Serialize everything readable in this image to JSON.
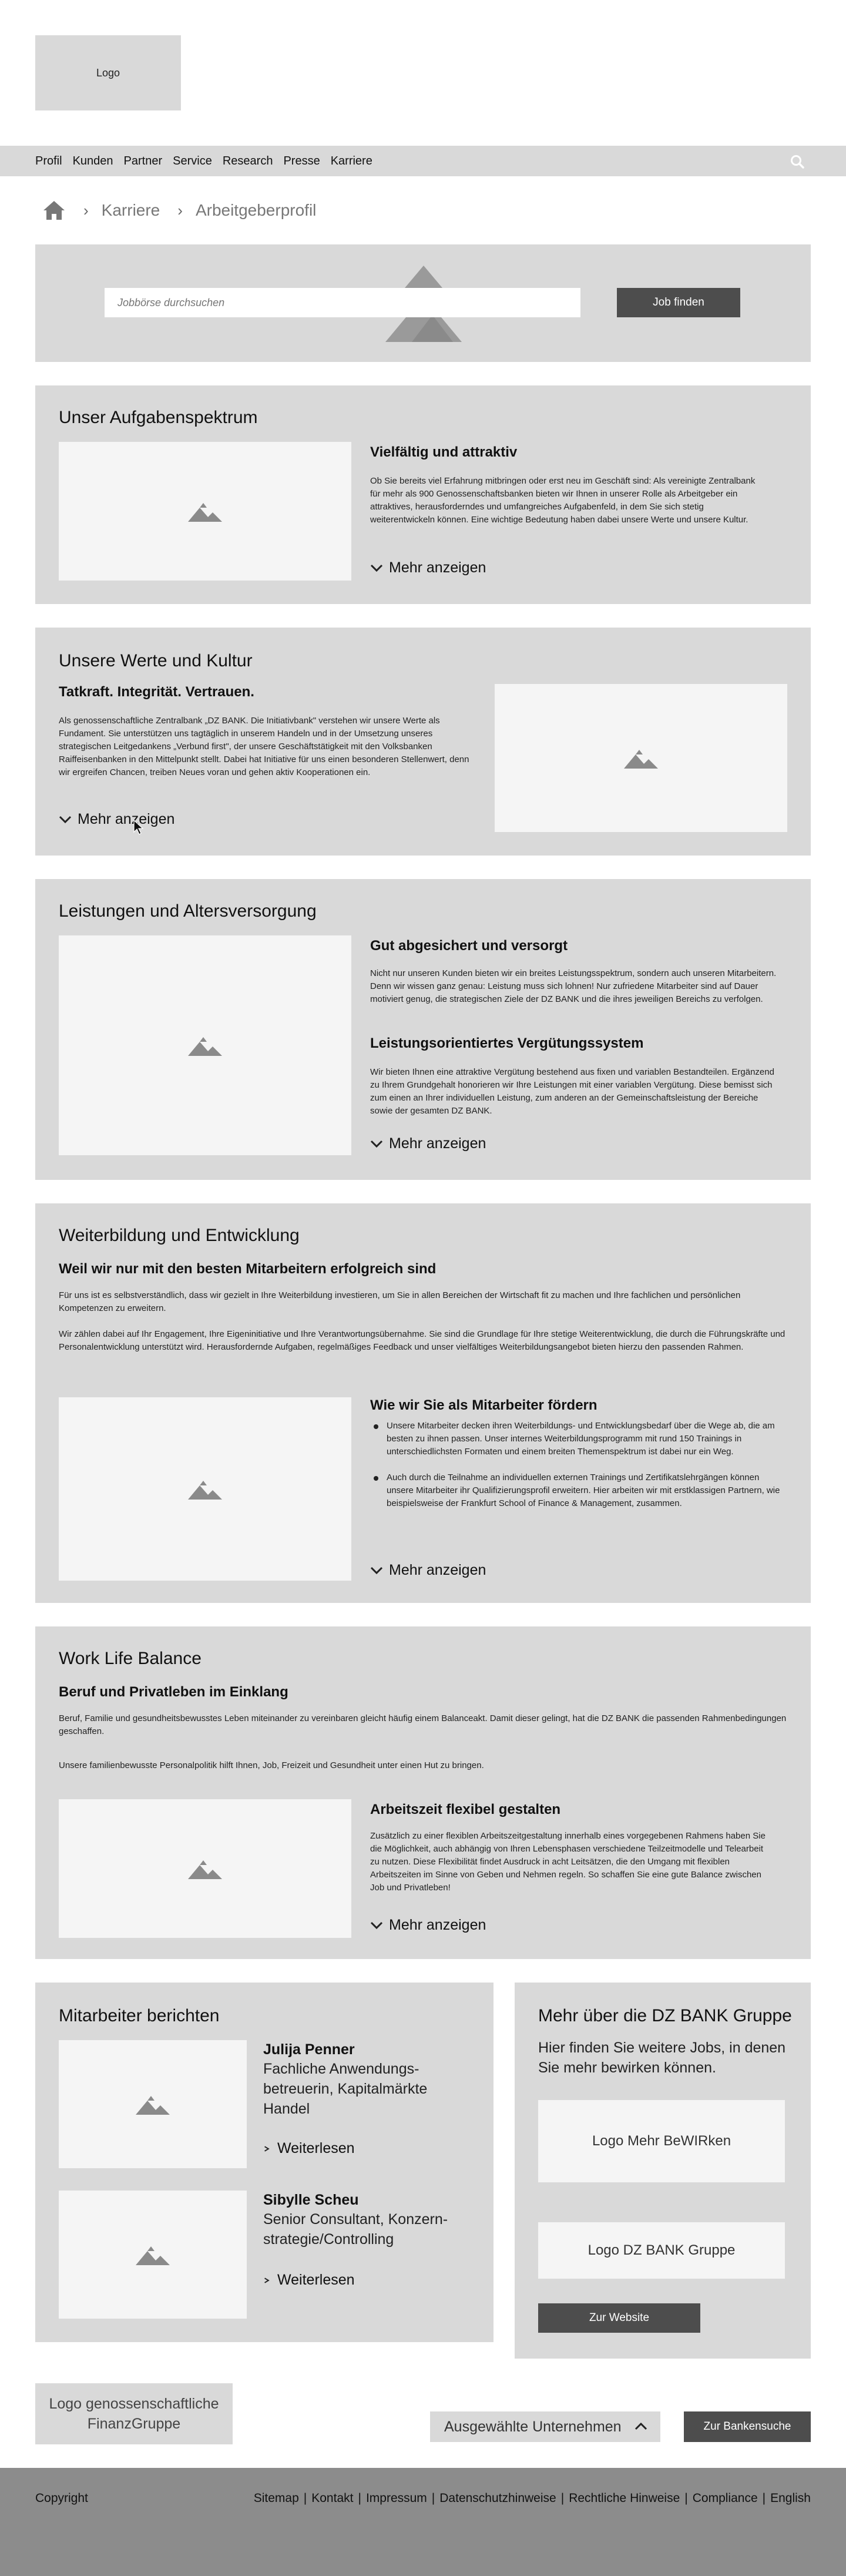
{
  "header": {
    "logo_label": "Logo"
  },
  "nav": {
    "items": [
      "Profil",
      "Kunden",
      "Partner",
      "Service",
      "Research",
      "Presse",
      "Karriere"
    ],
    "search_icon": "search-icon"
  },
  "breadcrumb": {
    "home_icon": "home-icon",
    "items": [
      "Karriere",
      "Arbeitgeberprofil"
    ]
  },
  "search": {
    "placeholder": "Jobbörse durchsuchen",
    "button": "Job finden"
  },
  "aufgaben": {
    "title": "Unser Aufgabenspektrum",
    "subtitle": "Vielfältig und attraktiv",
    "text": "Ob Sie bereits viel Erfahrung mitbringen oder erst neu im Geschäft sind: Als vereinigte Zentralbank für mehr als 900 Genossenschaftsbanken bieten wir Ihnen in unserer Rolle als Arbeitgeber ein attraktives, herausforderndes und umfangreiches Aufgabenfeld, in dem Sie sich stetig weiterentwickeln können. Eine wichtige Bedeutung haben dabei unsere Werte und unsere Kultur.",
    "more": "Mehr anzeigen"
  },
  "werte": {
    "title": "Unsere Werte und Kultur",
    "subtitle": "Tatkraft. Integrität. Vertrauen.",
    "text": "Als genossenschaftliche Zentralbank „DZ BANK. Die Initiativbank\" verstehen wir unsere Werte als Fundament. Sie unterstützen uns tagtäglich in unserem Handeln und in der Umsetzung unseres strategischen Leitgedankens „Verbund first\", der unsere Geschäftstätigkeit mit den Volksbanken Raiffeisenbanken in den Mittelpunkt stellt. Dabei hat Initiative für uns einen besonderen Stellenwert, denn wir ergreifen Chancen, treiben Neues voran und gehen aktiv Kooperationen ein.",
    "more": "Mehr anzeigen"
  },
  "leistungen": {
    "title": "Leistungen und Altersversorgung",
    "subtitle1": "Gut abgesichert und versorgt",
    "text1": "Nicht nur unseren Kunden bieten wir ein breites Leistungsspektrum, sondern auch unseren Mitarbeitern. Denn wir wissen ganz genau: Leistung muss sich lohnen! Nur zufriedene Mitarbeiter sind auf Dauer motiviert genug, die strategischen Ziele der DZ BANK und die ihres jeweiligen Bereichs zu verfolgen.",
    "subtitle2": "Leistungsorientiertes Vergütungssystem",
    "text2": "Wir bieten Ihnen eine attraktive Vergütung bestehend aus fixen und variablen Bestandteilen. Ergänzend zu Ihrem Grundgehalt honorieren wir Ihre Leistungen mit einer variablen Vergütung. Diese bemisst sich zum einen an Ihrer individuellen Leistung, zum anderen an der Gemeinschaftsleistung der Bereiche sowie der gesamten DZ BANK.",
    "more": "Mehr anzeigen"
  },
  "weiterbildung": {
    "title": "Weiterbildung und Entwicklung",
    "subtitle": "Weil wir nur mit den besten Mitarbeitern erfolgreich sind",
    "text1": "Für uns ist es selbstverständlich, dass wir gezielt in Ihre Weiterbildung investieren, um Sie in allen Bereichen der Wirtschaft fit zu machen und Ihre fachlichen und persönlichen Kompetenzen zu erweitern.",
    "text2": "Wir zählen dabei auf Ihr Engagement, Ihre Eigeninitiative und Ihre Verantwortungsübernahme. Sie sind die Grundlage für Ihre stetige Weiterentwicklung, die durch die Führungskräfte und Personalentwicklung unterstützt wird. Herausfordernde Aufgaben, regelmäßiges Feedback und unser vielfältiges Weiterbildungsangebot bieten hierzu den passenden Rahmen.",
    "subtitle2": "Wie wir Sie als Mitarbeiter fördern",
    "bullets": [
      "Unsere Mitarbeiter decken ihren Weiterbildungs- und Entwicklungsbedarf über die Wege ab, die am besten zu ihnen passen. Unser internes Weiterbildungsprogramm mit rund 150 Trainings in unterschiedlichsten Formaten und einem breiten Themenspektrum ist dabei nur ein Weg.",
      "Auch durch die Teilnahme an individuellen externen Trainings und Zertifikatslehrgängen können unsere Mitarbeiter ihr Qualifizierungsprofil erweitern. Hier arbeiten wir mit erstklassigen Partnern, wie beispielsweise der Frankfurt School of Finance & Management, zusammen."
    ],
    "more": "Mehr anzeigen"
  },
  "worklife": {
    "title": "Work Life Balance",
    "subtitle": "Beruf und Privatleben im Einklang",
    "text1": "Beruf, Familie und gesundheitsbewusstes Leben miteinander zu vereinbaren gleicht häufig einem Balanceakt. Damit dieser gelingt, hat die DZ BANK die passenden Rahmenbedingungen geschaffen.",
    "text2": "Unsere familienbewusste Personalpolitik hilft Ihnen, Job, Freizeit und Gesundheit unter einen Hut zu bringen.",
    "subtitle2": "Arbeitszeit flexibel gestalten",
    "text3": "Zusätzlich zu einer flexiblen Arbeitszeitgestaltung innerhalb eines vorgegebenen Rahmens haben Sie die Möglichkeit, auch abhängig von Ihren Lebensphasen verschiedene Teilzeitmodelle und Telearbeit zu nutzen. Diese Flexibilität findet Ausdruck in acht Leitsätzen, die den Umgang mit flexiblen Arbeitszeiten im Sinne von Geben und Nehmen regeln. So schaffen Sie eine gute Balance zwischen Job und Privatleben!",
    "more": "Mehr anzeigen"
  },
  "mitarbeiter": {
    "title": "Mitarbeiter berichten",
    "people": [
      {
        "name": "Julija Penner",
        "role": "Fachliche Anwendungs-betreuerin, Kapitalmärkte Handel",
        "link": "Weiterlesen"
      },
      {
        "name": "Sibylle Scheu",
        "role": "Senior Consultant, Konzern-strategie/Controlling",
        "link": "Weiterlesen"
      }
    ]
  },
  "gruppe": {
    "title": "Mehr über die DZ BANK Gruppe",
    "text": "Hier finden Sie weitere Jobs, in denen Sie mehr bewirken können.",
    "logo1": "Logo Mehr BeWIRken",
    "logo2": "Logo DZ BANK Gruppe",
    "button": "Zur Website"
  },
  "bottom": {
    "logo": "Logo genossenschaftliche FinanzGruppe",
    "companies": "Ausgewählte Unternehmen",
    "bank_search": "Zur Bankensuche"
  },
  "footer": {
    "copyright": "Copyright",
    "links": [
      "Sitemap",
      "Kontakt",
      "Impressum",
      "Datenschutzhinweise",
      "Rechtliche Hinweise",
      "Compliance",
      "English"
    ]
  },
  "colors": {
    "panel": "#d9d9d9",
    "placeholder": "#f5f5f5",
    "button": "#4d4d4d",
    "footer": "#8c8c8c"
  }
}
